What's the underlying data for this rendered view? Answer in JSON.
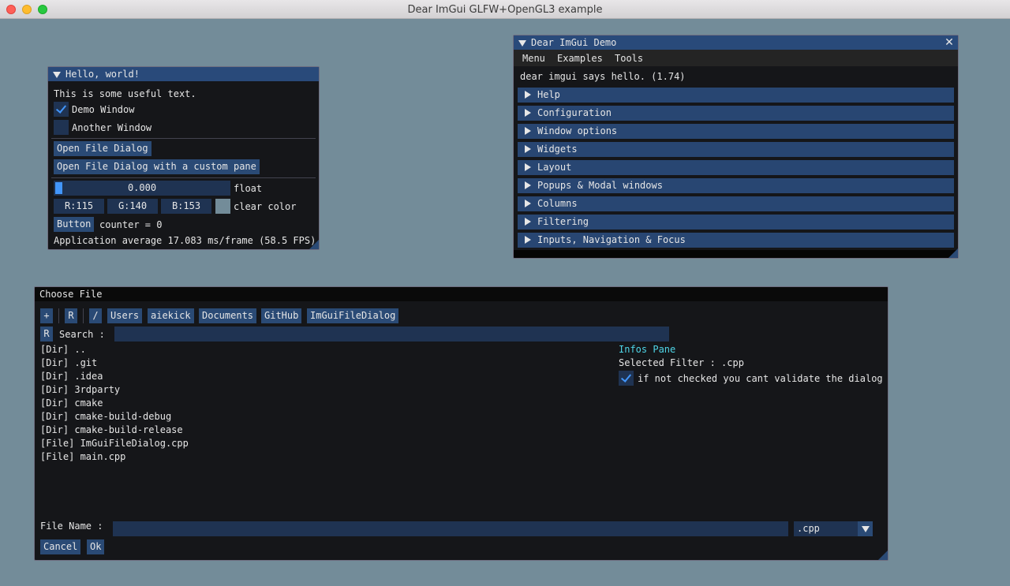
{
  "app": {
    "title": "Dear ImGui GLFW+OpenGL3 example"
  },
  "hello": {
    "title": "Hello, world!",
    "text": "This is some useful text.",
    "demo_window": {
      "label": "Demo Window",
      "checked": true
    },
    "another_window": {
      "label": "Another Window",
      "checked": false
    },
    "open_file_dialog": "Open File Dialog",
    "open_file_dialog_custom": "Open File Dialog with a custom pane",
    "float_value": "0.000",
    "float_fraction": 0.0,
    "float_label": "float",
    "r": "R:115",
    "g": "G:140",
    "b": "B:153",
    "clear_color_hex": "#738c99",
    "clear_color_label": "clear color",
    "button": "Button",
    "counter": "counter = 0",
    "fps": "Application average 17.083 ms/frame (58.5 FPS)"
  },
  "demo": {
    "title": "Dear ImGui Demo",
    "menu": [
      "Menu",
      "Examples",
      "Tools"
    ],
    "hello_text": "dear imgui says hello. (1.74)",
    "headers": [
      "Help",
      "Configuration",
      "Window options",
      "Widgets",
      "Layout",
      "Popups & Modal windows",
      "Columns",
      "Filtering",
      "Inputs, Navigation & Focus"
    ]
  },
  "file_dialog": {
    "title": "Choose File",
    "path_buttons": [
      "+",
      "R",
      "/",
      "Users",
      "aiekick",
      "Documents",
      "GitHub",
      "ImGuiFileDialog"
    ],
    "search_reset": "R",
    "search_label": "Search :",
    "search_value": "",
    "entries": [
      "[Dir] ..",
      "[Dir] .git",
      "[Dir] .idea",
      "[Dir] 3rdparty",
      "[Dir] cmake",
      "[Dir] cmake-build-debug",
      "[Dir] cmake-build-release",
      "[File] ImGuiFileDialog.cpp",
      "[File] main.cpp"
    ],
    "infos_title": "Infos Pane",
    "selected_filter": "Selected Filter : .cpp",
    "validate_checkbox": {
      "label": "if not checked you cant validate the dialog",
      "checked": true
    },
    "file_name_label": "File Name :",
    "file_name_value": "",
    "filter_value": ".cpp",
    "cancel": "Cancel",
    "ok": "Ok"
  },
  "colors": {
    "accent": "#4296fa",
    "button": "#2a4a75",
    "frame": "#1f3352",
    "header": "#284672",
    "infos": "#4fd6e8"
  }
}
